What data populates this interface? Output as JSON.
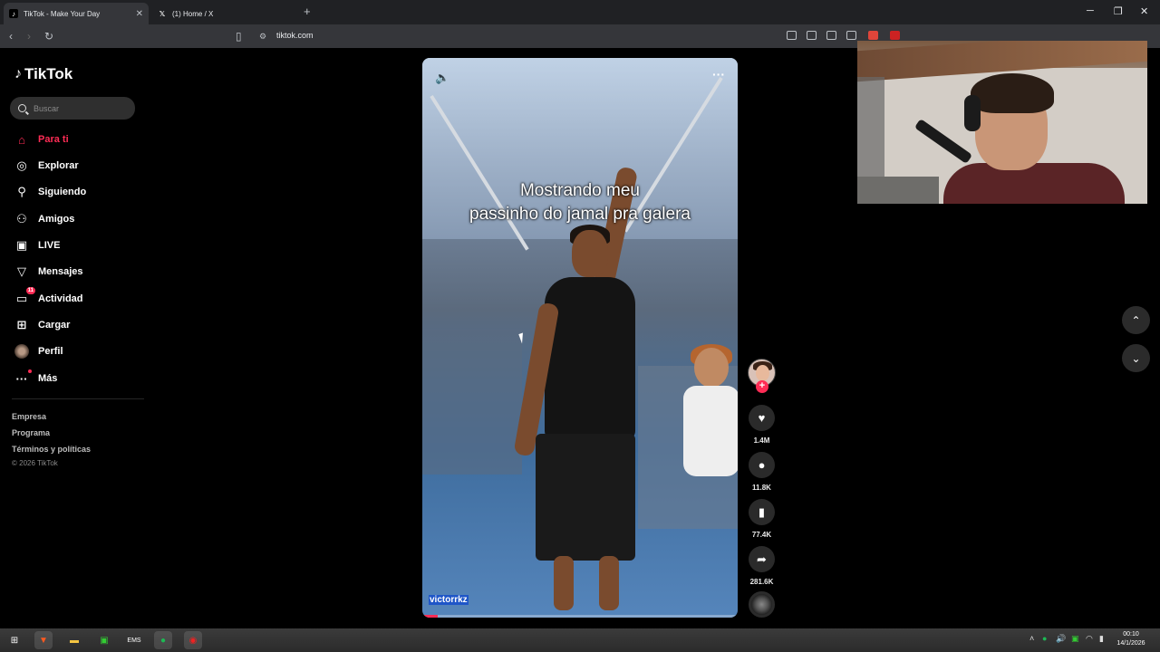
{
  "browser": {
    "tabs": [
      {
        "title": "TikTok - Make Your Day",
        "active": true
      },
      {
        "title": "(1) Home / X",
        "active": false
      }
    ],
    "url": "tiktok.com"
  },
  "sidebar": {
    "logo": "TikTok",
    "search_placeholder": "Buscar",
    "items": [
      {
        "label": "Para ti",
        "icon": "home-icon",
        "active": true
      },
      {
        "label": "Explorar",
        "icon": "compass-icon"
      },
      {
        "label": "Siguiendo",
        "icon": "following-icon"
      },
      {
        "label": "Amigos",
        "icon": "friends-icon"
      },
      {
        "label": "LIVE",
        "icon": "live-icon"
      },
      {
        "label": "Mensajes",
        "icon": "messages-icon"
      },
      {
        "label": "Actividad",
        "icon": "activity-icon",
        "badge": "11"
      },
      {
        "label": "Cargar",
        "icon": "upload-icon"
      },
      {
        "label": "Perfil",
        "icon": "profile-avatar"
      },
      {
        "label": "Más",
        "icon": "more-icon"
      }
    ],
    "footer_links": [
      "Empresa",
      "Programa",
      "Términos y políticas"
    ],
    "copyright": "© 2026 TikTok"
  },
  "video": {
    "caption_line1": "Mostrando meu",
    "caption_line2": "passinho do jamal pra galera",
    "author": "victorrkz",
    "progress": 0.05
  },
  "actions": {
    "likes": "1.4M",
    "comments": "11.8K",
    "saves": "77.4K",
    "shares": "281.6K"
  },
  "taskbar": {
    "time": "00:10",
    "date": "14/1/2026",
    "lang": "ENG"
  },
  "colors": {
    "accent": "#fe2c55",
    "background": "#000000",
    "selection": "#1f56c8"
  }
}
